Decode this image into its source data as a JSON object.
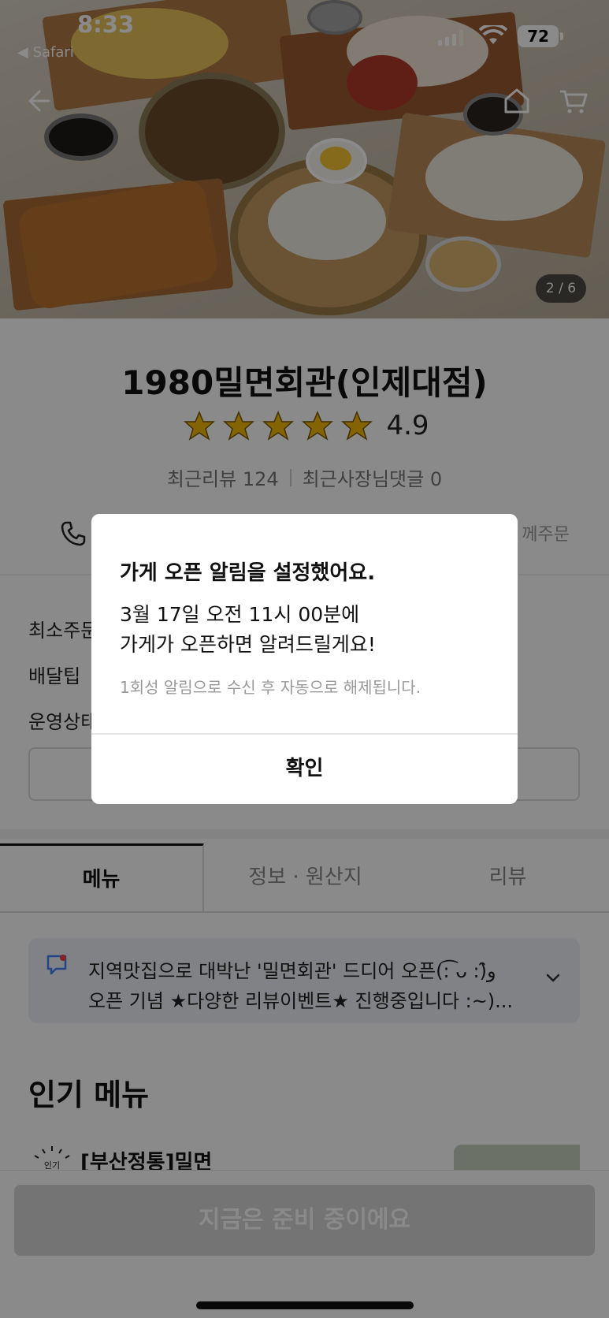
{
  "status_bar": {
    "time": "8:33",
    "back_app": "◀ Safari",
    "battery": "72"
  },
  "hero": {
    "photo_counter": "2 / 6"
  },
  "store": {
    "name": "1980밀면회관(인제대점)",
    "rating": "4.9",
    "star_count": 5,
    "recent_reviews": "최근리뷰 124",
    "owner_replies": "최근사장님댓글 0",
    "action_right_partial": "께주문"
  },
  "info": {
    "min_order_partial": "최소주문",
    "delivery_tip_partial": "배달팁",
    "hours_partial": "운영상태"
  },
  "tabs": [
    {
      "label": "메뉴",
      "active": true
    },
    {
      "label": "정보 · 원산지",
      "active": false
    },
    {
      "label": "리뷰",
      "active": false
    }
  ],
  "notice": {
    "line1": "지역맛집으로 대박난 '밀면회관' 드디어 오픈(:͡ ᴗ :)و̑̑",
    "line2": "오픈 기념 ★다양한 리뷰이벤트★ 진행중입니다 :~)..."
  },
  "popular": {
    "title": "인기 메뉴",
    "badge": "인기",
    "first_item_partial": "[부산정통]밀면"
  },
  "bottom": {
    "order_button": "지금은 준비 중이에요"
  },
  "modal": {
    "title": "가게 오픈 알림을 설정했어요.",
    "line1": "3월 17일 오전 11시 00분에",
    "line2": "가게가 오픈하면 알려드릴게요!",
    "note": "1회성 알림으로 수신 후 자동으로 해제됩니다.",
    "confirm": "확인"
  },
  "colors": {
    "accent_star": "#f2b705",
    "notice_icon": "#3b82f6",
    "disabled_button": "#d6d6d6"
  }
}
